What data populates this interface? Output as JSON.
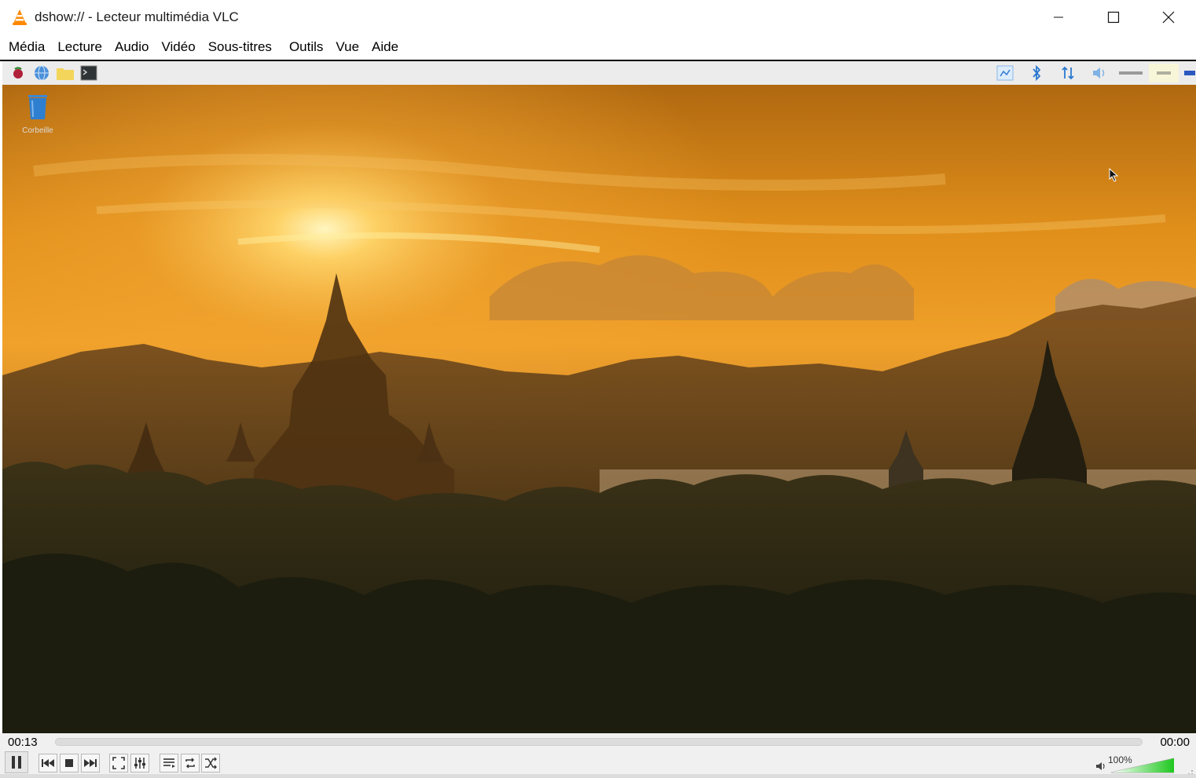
{
  "window": {
    "title": "dshow:// - Lecteur multimédia VLC",
    "app_icon": "vlc-cone-icon"
  },
  "menu": {
    "items": [
      "Média",
      "Lecture",
      "Audio",
      "Vidéo",
      "Sous-titres",
      "Outils",
      "Vue",
      "Aide"
    ]
  },
  "video": {
    "desktop_icon_label": "Corbeille",
    "launcher_icons": [
      "raspberry-menu-icon",
      "globe-browser-icon",
      "folder-icon",
      "terminal-icon"
    ],
    "tray_icons": [
      "network-icon",
      "bluetooth-icon",
      "transfer-icon",
      "volume-icon",
      "clock-icon",
      "cpu-icon"
    ]
  },
  "controls": {
    "elapsed": "00:13",
    "total": "00:00",
    "progress": 0.0,
    "volume_label": "100%",
    "volume_level": 1.0
  },
  "colors": {
    "accent": "#00a000",
    "sky_top": "#c77414",
    "sun": "#fff2a8"
  }
}
